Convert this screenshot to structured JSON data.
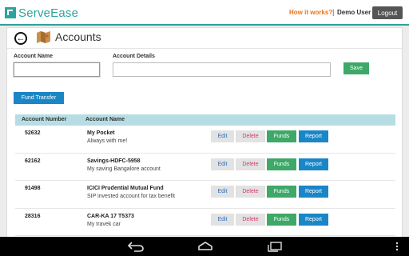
{
  "header": {
    "brand": "ServeEase",
    "how_link": "How it works?",
    "separator": "|",
    "user": "Demo User",
    "logout_label": "Logout"
  },
  "page": {
    "title": "Accounts"
  },
  "form": {
    "account_name_label": "Account Name",
    "account_details_label": "Account Details",
    "account_name_value": "",
    "account_details_value": "",
    "save_label": "Save",
    "fund_transfer_label": "Fund Transfer"
  },
  "table": {
    "columns": [
      "Account Number",
      "Account Name"
    ],
    "rows": [
      {
        "number": "52632",
        "name": "My Pocket",
        "description": "Always with me!",
        "edit": "Edit",
        "delete": "Delete",
        "funds": "Funds",
        "report": "Report"
      },
      {
        "number": "62162",
        "name": "Savings-HDFC-5958",
        "description": "My saving Bangalore account",
        "edit": "Edit",
        "delete": "Delete",
        "funds": "Funds",
        "report": "Report"
      },
      {
        "number": "91498",
        "name": "ICICI Prudential Mutual Fund",
        "description": "SIP invested account for tax benefit",
        "edit": "Edit",
        "delete": "Delete",
        "funds": "Funds",
        "report": "Report"
      },
      {
        "number": "28316",
        "name": "CAR-KA 17 T5373",
        "description": "My travek car",
        "edit": "Edit",
        "delete": "Delete",
        "funds": "Funds",
        "report": "Report"
      }
    ]
  },
  "icons": {
    "brand": "serveease-logo-icon",
    "back": "back-arrow-icon",
    "page": "map-icon",
    "nav_back": "android-back-icon",
    "nav_home": "android-home-icon",
    "nav_recent": "android-recents-icon",
    "nav_menu": "android-menu-icon"
  },
  "colors": {
    "brand": "#2aa59c",
    "link_orange": "#e8741e",
    "save_green": "#3ea868",
    "primary_blue": "#1b86c6",
    "delete_pink": "#d43a68",
    "table_header": "#b7dde4"
  }
}
